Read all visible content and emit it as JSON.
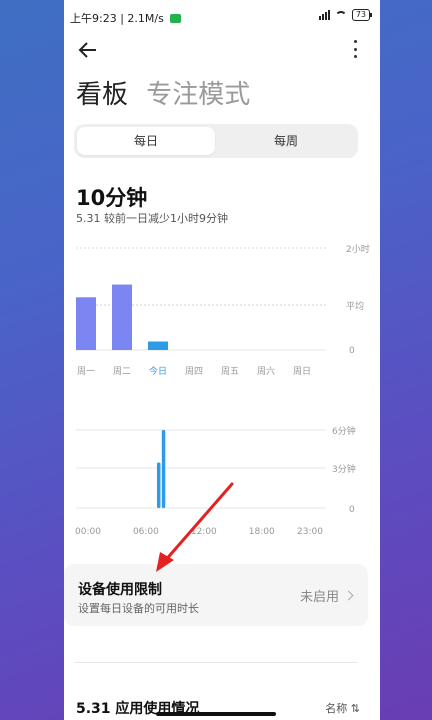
{
  "status_bar": {
    "time_net": "上午9:23 | 2.1M/s",
    "battery": "73"
  },
  "tabs": {
    "active": "看板",
    "inactive": "专注模式"
  },
  "segment": {
    "daily": "每日",
    "weekly": "每周"
  },
  "summary": {
    "total": "10分钟",
    "compare": "5.31 较前一日减少1小时9分钟"
  },
  "weekly_chart": {
    "y_labels": {
      "top": "2小时",
      "avg": "平均",
      "zero": "0"
    },
    "days": [
      "周一",
      "周二",
      "今日",
      "周四",
      "周五",
      "周六",
      "周日"
    ],
    "colors": {
      "past": "#7b86f2",
      "today": "#2d9be8",
      "today_label": "#2d9be8"
    }
  },
  "chart_data": [
    {
      "type": "bar",
      "categories": [
        "周一",
        "周二",
        "今日",
        "周四",
        "周五",
        "周六",
        "周日"
      ],
      "values": [
        62,
        77,
        10,
        0,
        0,
        0,
        0
      ],
      "ylabel": "",
      "ylim": [
        0,
        120
      ],
      "y_ticks": [
        "0",
        "平均",
        "2小时"
      ]
    },
    {
      "type": "bar",
      "x_ticks": [
        "00:00",
        "06:00",
        "12:00",
        "18:00",
        "23:00"
      ],
      "y_ticks": [
        "0",
        "3分钟",
        "6分钟"
      ],
      "points": [
        {
          "hour": 7.3,
          "minutes": 3.5
        },
        {
          "hour": 7.8,
          "minutes": 6.0
        }
      ],
      "ylim": [
        0,
        6
      ]
    }
  ],
  "hourly_chart": {
    "y_labels": {
      "top": "6分钟",
      "mid": "3分钟",
      "zero": "0"
    },
    "x_labels": [
      "00:00",
      "06:00",
      "12:00",
      "18:00",
      "23:00"
    ]
  },
  "limit_card": {
    "title": "设备使用限制",
    "desc": "设置每日设备的可用时长",
    "status": "未启用"
  },
  "section": {
    "title": "5.31 应用使用情况",
    "sort": "名称 ⇅"
  },
  "colors": {
    "annotation_arrow": "#e52020"
  }
}
